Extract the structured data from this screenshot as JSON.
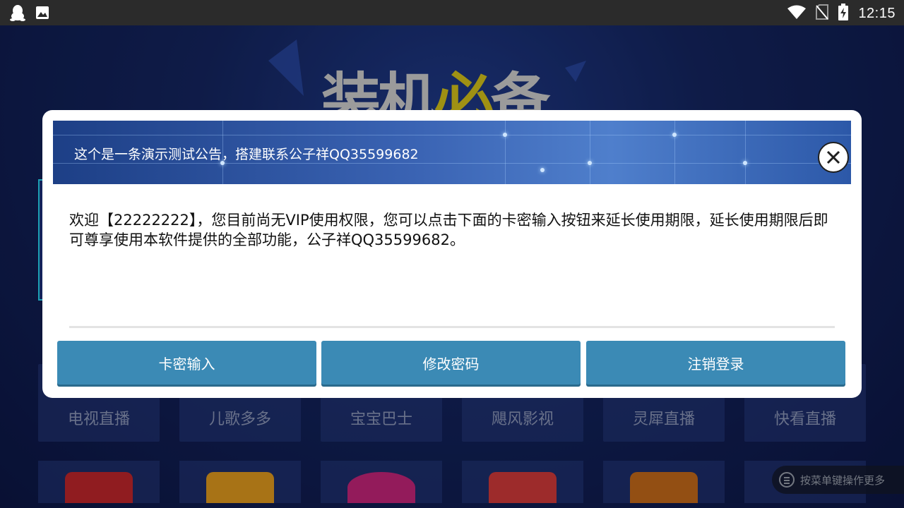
{
  "status_bar": {
    "time": "12:15",
    "left_icons": [
      "qq-penguin-icon",
      "image-icon"
    ],
    "right_icons": [
      "wifi-icon",
      "no-sim-icon",
      "battery-charging-icon"
    ]
  },
  "background_app": {
    "logo_text_a": "装机",
    "logo_text_b": "必",
    "logo_text_c": "备",
    "tiles": [
      "电视直播",
      "儿歌多多",
      "宝宝巴士",
      "飓风影视",
      "灵犀直播",
      "快看直播"
    ],
    "menu_hint": "按菜单键操作更多"
  },
  "dialog": {
    "banner_text": "这个是一条演示测试公告，搭建联系公子祥QQ35599682",
    "message": "欢迎【22222222】，您目前尚无VIP使用权限，您可以点击下面的卡密输入按钮来延长使用期限，延长使用期限后即可尊享使用本软件提供的全部功能，公子祥QQ35599682。",
    "buttons": {
      "card_input": "卡密输入",
      "change_password": "修改密码",
      "logout": "注销登录"
    }
  },
  "colors": {
    "button": "#3b8ab5",
    "banner": "#3a63b3",
    "status_bar": "#2b2b2b"
  }
}
